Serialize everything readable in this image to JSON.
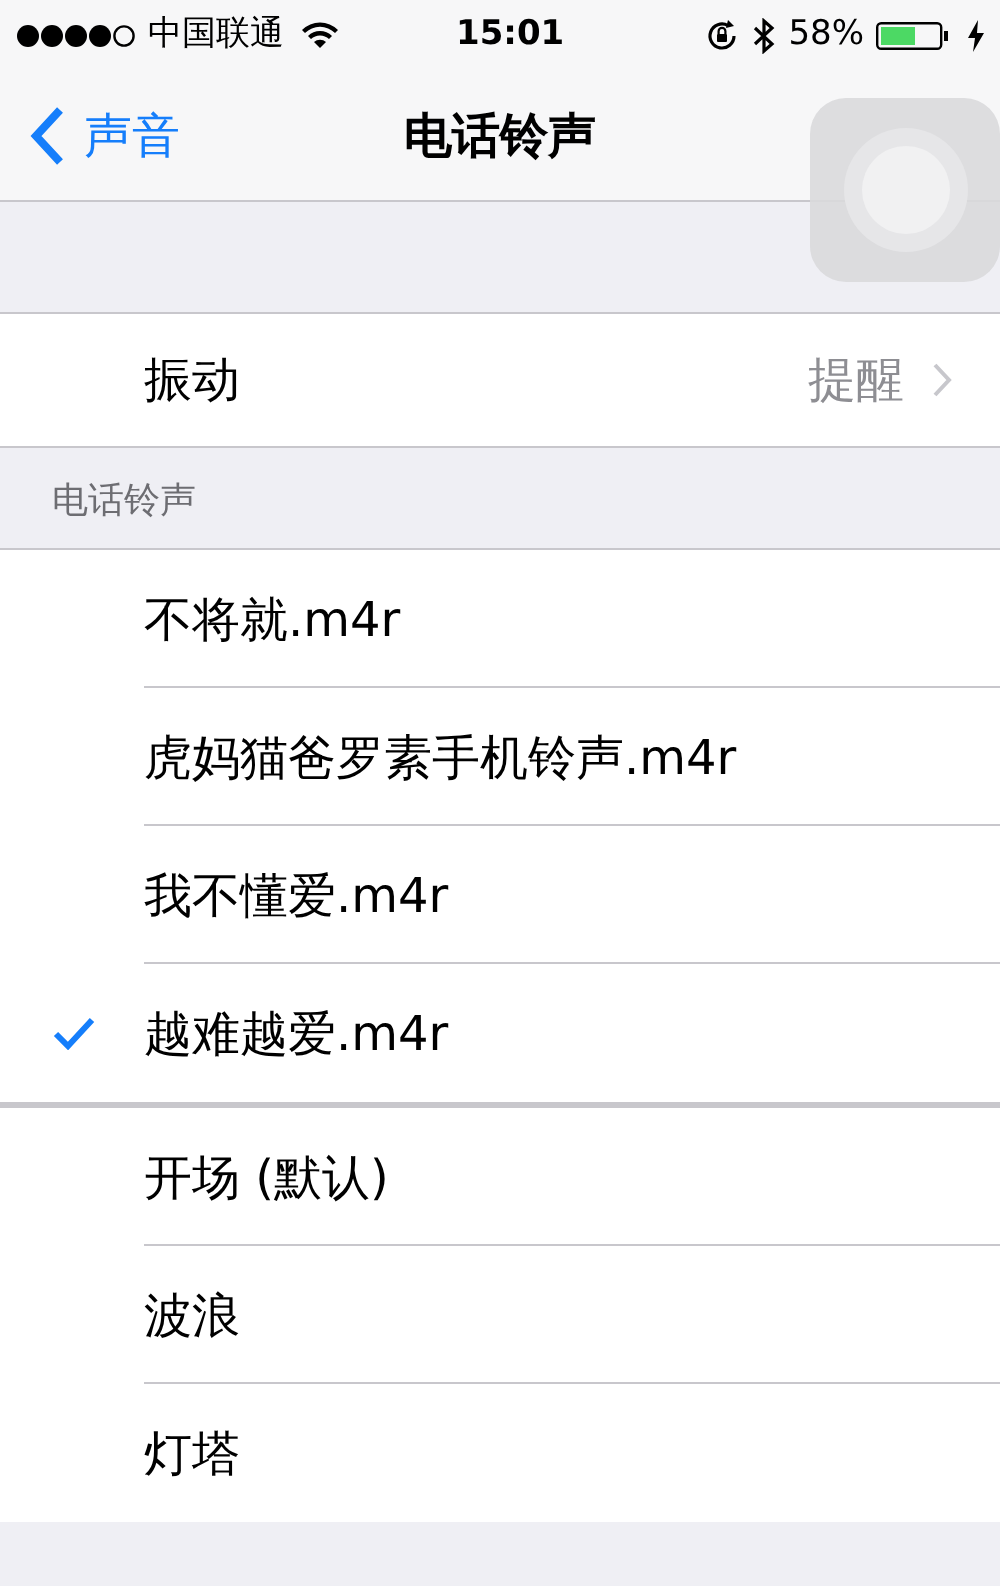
{
  "status_bar": {
    "carrier": "中国联通",
    "time": "15:01",
    "battery": "58%"
  },
  "nav": {
    "back": "声音",
    "title": "电话铃声"
  },
  "vibration": {
    "label": "振动",
    "value": "提醒"
  },
  "section_header": "电话铃声",
  "custom_tones": [
    {
      "label": "不将就.m4r",
      "selected": false
    },
    {
      "label": "虎妈猫爸罗素手机铃声.m4r",
      "selected": false
    },
    {
      "label": "我不懂爱.m4r",
      "selected": false
    },
    {
      "label": "越难越爱.m4r",
      "selected": true
    }
  ],
  "standard_tones": [
    {
      "label": "开场 (默认)",
      "selected": false
    },
    {
      "label": "波浪",
      "selected": false
    },
    {
      "label": "灯塔",
      "selected": false
    }
  ]
}
